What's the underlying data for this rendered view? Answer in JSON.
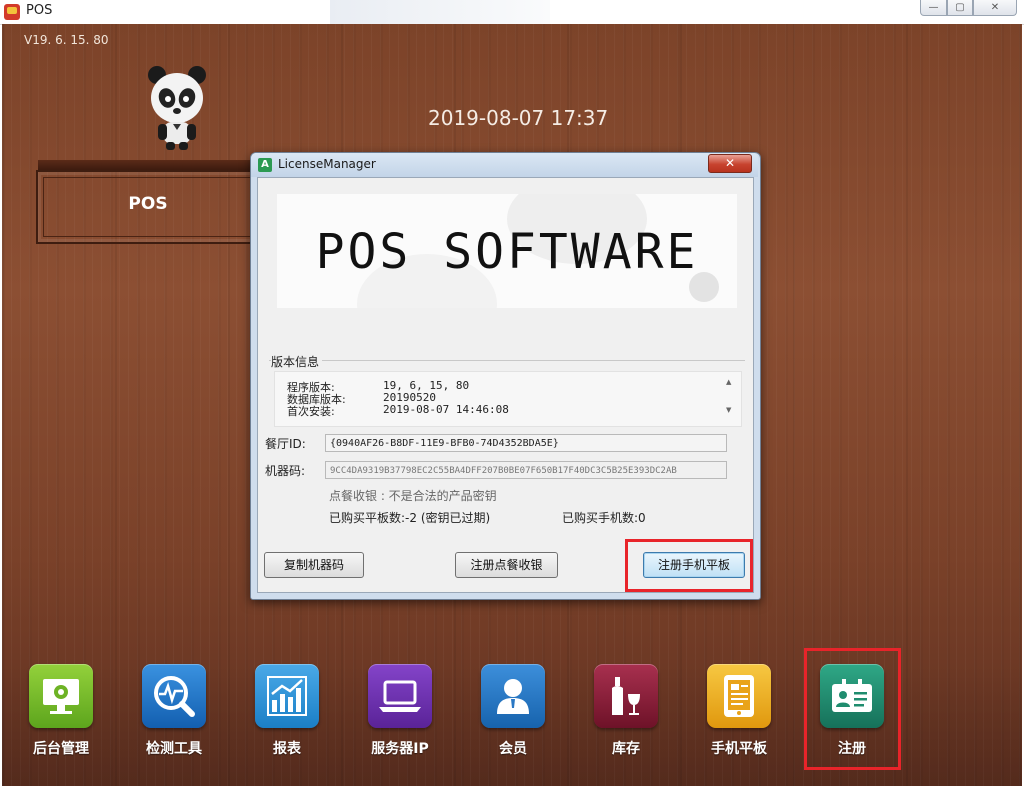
{
  "window": {
    "title": "POS",
    "min_symbol": "—",
    "max_symbol": "▢",
    "close_symbol": "✕"
  },
  "version": "V19. 6. 15. 80",
  "datetime": "2019-08-07 17:37",
  "pos_label": "POS",
  "dock": [
    {
      "label": "后台管理",
      "icon": "monitor-gear-icon",
      "color": "#7dbf2a"
    },
    {
      "label": "检测工具",
      "icon": "magnifier-pulse-icon",
      "color": "#1f78c8"
    },
    {
      "label": "报表",
      "icon": "bar-chart-icon",
      "color": "#2a93d6"
    },
    {
      "label": "服务器IP",
      "icon": "laptop-icon",
      "color": "#6d2fb0"
    },
    {
      "label": "会员",
      "icon": "person-icon",
      "color": "#1e73be"
    },
    {
      "label": "库存",
      "icon": "wine-icon",
      "color": "#8e1f3a"
    },
    {
      "label": "手机平板",
      "icon": "tablet-icon",
      "color": "#f2b320"
    },
    {
      "label": "注册",
      "icon": "id-card-icon",
      "color": "#1f8c6e"
    }
  ],
  "dialog": {
    "title": "LicenseManager",
    "icon_letter": "A",
    "close_symbol": "✕",
    "banner": "POS SOFTWARE",
    "version_group_title": "版本信息",
    "version_rows": [
      {
        "label": "程序版本:",
        "value": "19, 6, 15, 80"
      },
      {
        "label": "数据库版本:",
        "value": "20190520"
      },
      {
        "label": "首次安装:",
        "value": "2019-08-07 14:46:08"
      }
    ],
    "restaurant_id_label": "餐厅ID:",
    "restaurant_id": "{0940AF26-B8DF-11E9-BFB0-74D4352BDA5E}",
    "machine_code_label": "机器码:",
    "machine_code": "9CC4DA9319B37798EC2C55BA4DFF207B0BE07F650B17F40DC3C5B25E393DC2AB",
    "status_line": "点餐收银 : 不是合法的产品密钥",
    "tablets_line": "已购买平板数:-2 (密钥已过期)",
    "phones_line": "已购买手机数:0",
    "btn_copy": "复制机器码",
    "btn_register_pos": "注册点餐收银",
    "btn_register_tablet": "注册手机平板"
  }
}
